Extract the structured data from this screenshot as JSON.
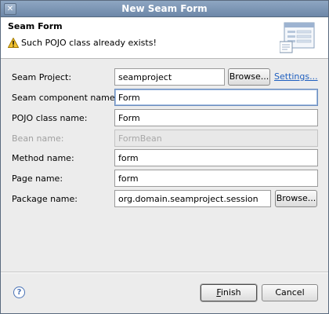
{
  "window": {
    "title": "New Seam Form",
    "close_glyph": "✕"
  },
  "banner": {
    "title": "Seam Form",
    "message": "Such POJO class already exists!",
    "message_icon": "warning-icon",
    "graphic_icon": "wizard-form-icon"
  },
  "form": {
    "project": {
      "label": "Seam Project:",
      "value": "seamproject",
      "browse_label": "Browse...",
      "settings_label": "Settings..."
    },
    "component": {
      "label": "Seam component name:",
      "value": "Form"
    },
    "pojo": {
      "label": "POJO class name:",
      "value": "Form"
    },
    "bean": {
      "label": "Bean name:",
      "value": "FormBean",
      "disabled": true
    },
    "method": {
      "label": "Method name:",
      "value": "form"
    },
    "page": {
      "label": "Page name:",
      "value": "form"
    },
    "package": {
      "label": "Package name:",
      "value": "org.domain.seamproject.session",
      "browse_label": "Browse..."
    }
  },
  "footer": {
    "help_glyph": "?",
    "finish_first": "F",
    "finish_rest": "inish",
    "cancel_label": "Cancel"
  }
}
